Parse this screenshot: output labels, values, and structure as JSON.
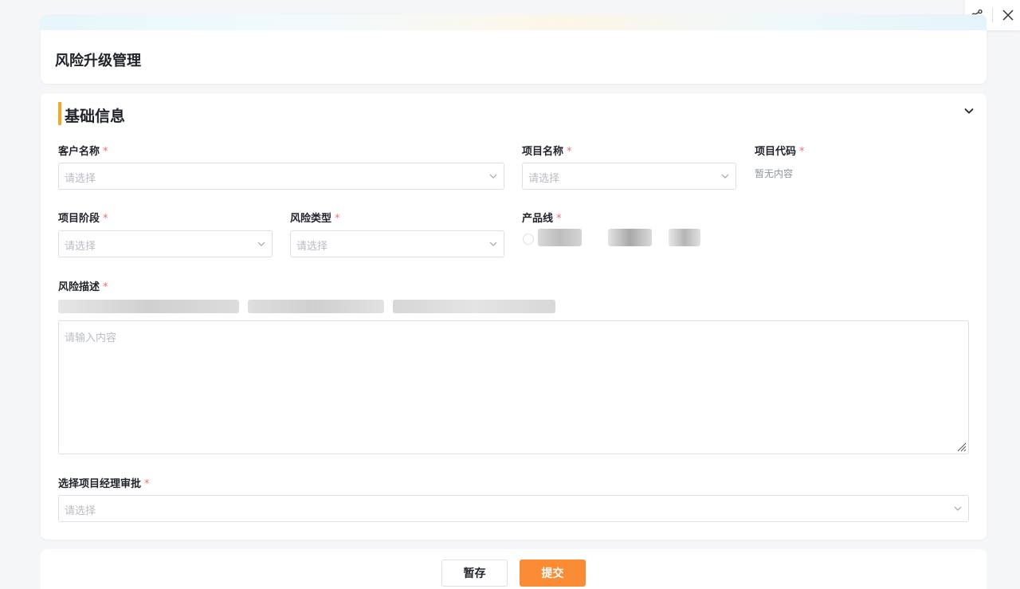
{
  "header": {
    "title": "风险升级管理"
  },
  "section": {
    "title": "基础信息"
  },
  "fields": {
    "customer_name": {
      "label": "客户名称",
      "required": "*",
      "placeholder": "请选择"
    },
    "project_name": {
      "label": "项目名称",
      "required": "*",
      "placeholder": "请选择"
    },
    "project_code": {
      "label": "项目代码",
      "required": "*",
      "value": "暂无内容"
    },
    "project_stage": {
      "label": "项目阶段",
      "required": "*",
      "placeholder": "请选择"
    },
    "risk_type": {
      "label": "风险类型",
      "required": "*",
      "placeholder": "请选择"
    },
    "product_line": {
      "label": "产品线",
      "required": "*"
    },
    "risk_description": {
      "label": "风险描述",
      "required": "*",
      "placeholder": "请输入内容"
    },
    "pm_approval": {
      "label": "选择项目经理审批",
      "required": "*",
      "placeholder": "请选择"
    }
  },
  "buttons": {
    "draft": "暂存",
    "submit": "提交"
  },
  "icons": {
    "share": "share-icon",
    "close": "close-icon",
    "collapse": "chevron-down-icon",
    "select_arrow": "chevron-down-icon",
    "resize": "resize-grip-icon"
  },
  "colors": {
    "accent": "#f5a623",
    "submit": "#fa8c35",
    "required": "#f56c6c"
  }
}
